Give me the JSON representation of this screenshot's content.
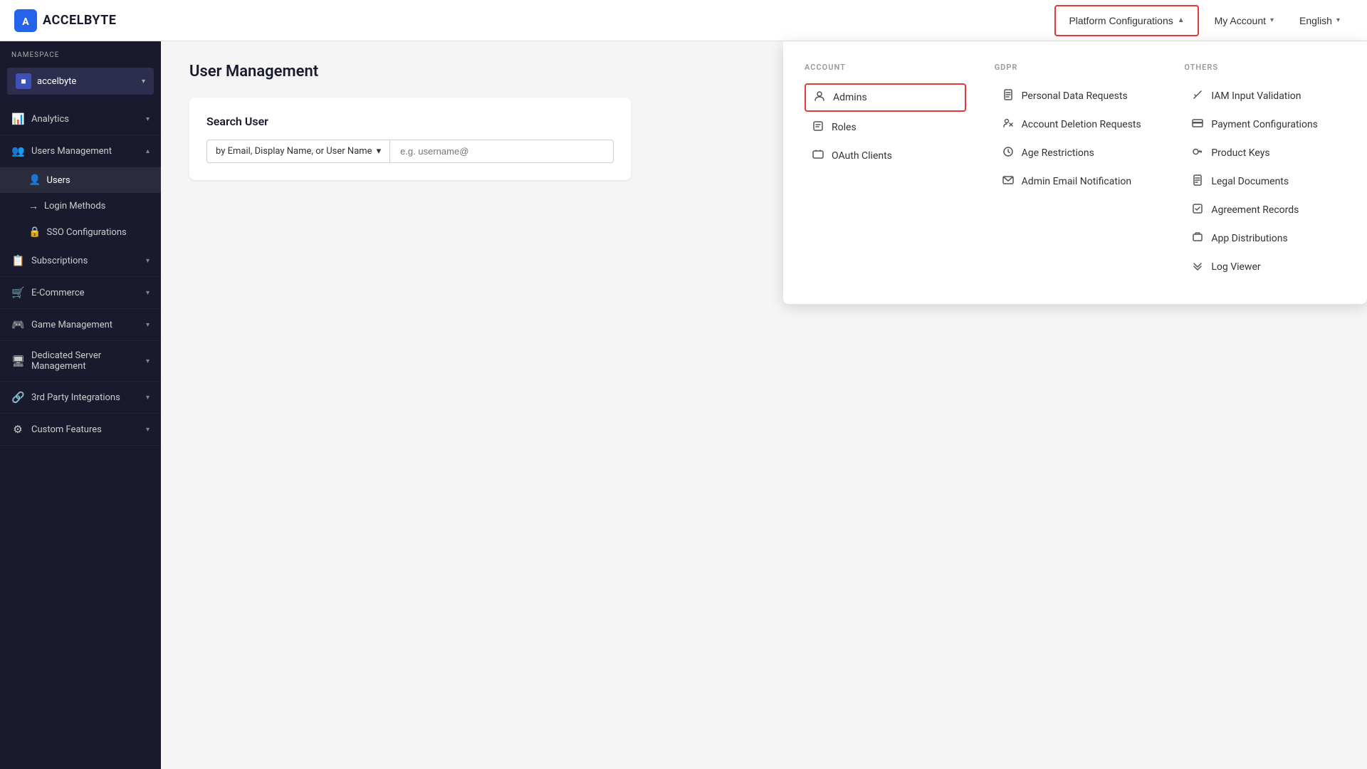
{
  "app": {
    "logo_text": "ACCELBYTE",
    "logo_icon": "A"
  },
  "topnav": {
    "platform_configurations_label": "Platform Configurations",
    "my_account_label": "My Account",
    "english_label": "English"
  },
  "namespace": {
    "label": "NAMESPACE",
    "name": "accelbyte",
    "icon": "■"
  },
  "sidebar": {
    "analytics_label": "Analytics",
    "users_management_label": "Users Management",
    "users_label": "Users",
    "login_methods_label": "Login Methods",
    "sso_configurations_label": "SSO Configurations",
    "subscriptions_label": "Subscriptions",
    "ecommerce_label": "E-Commerce",
    "game_management_label": "Game Management",
    "dedicated_server_label": "Dedicated Server Management",
    "third_party_label": "3rd Party Integrations",
    "custom_features_label": "Custom Features"
  },
  "content": {
    "page_title": "User Management",
    "search_section_title": "Search User",
    "search_select_label": "by Email, Display Name, or User Name",
    "search_placeholder": "e.g. username@"
  },
  "dropdown": {
    "account_header": "ACCOUNT",
    "gdpr_header": "GDPR",
    "others_header": "OTHERS",
    "account_items": [
      {
        "icon": "👤",
        "label": "Admins",
        "highlighted": true
      },
      {
        "icon": "☑",
        "label": "Roles",
        "highlighted": false
      },
      {
        "icon": "🔲",
        "label": "OAuth Clients",
        "highlighted": false
      }
    ],
    "gdpr_items": [
      {
        "icon": "📄",
        "label": "Personal Data Requests"
      },
      {
        "icon": "👥",
        "label": "Account Deletion Requests"
      },
      {
        "icon": "🛡",
        "label": "Age Restrictions"
      },
      {
        "icon": "✉",
        "label": "Admin Email Notification"
      }
    ],
    "others_items": [
      {
        "icon": "✏",
        "label": "IAM Input Validation"
      },
      {
        "icon": "💳",
        "label": "Payment Configurations"
      },
      {
        "icon": "🔑",
        "label": "Product Keys"
      },
      {
        "icon": "📋",
        "label": "Legal Documents"
      },
      {
        "icon": "📝",
        "label": "Agreement Records"
      },
      {
        "icon": "📦",
        "label": "App Distributions"
      },
      {
        "icon": "</>",
        "label": "Log Viewer"
      }
    ]
  }
}
